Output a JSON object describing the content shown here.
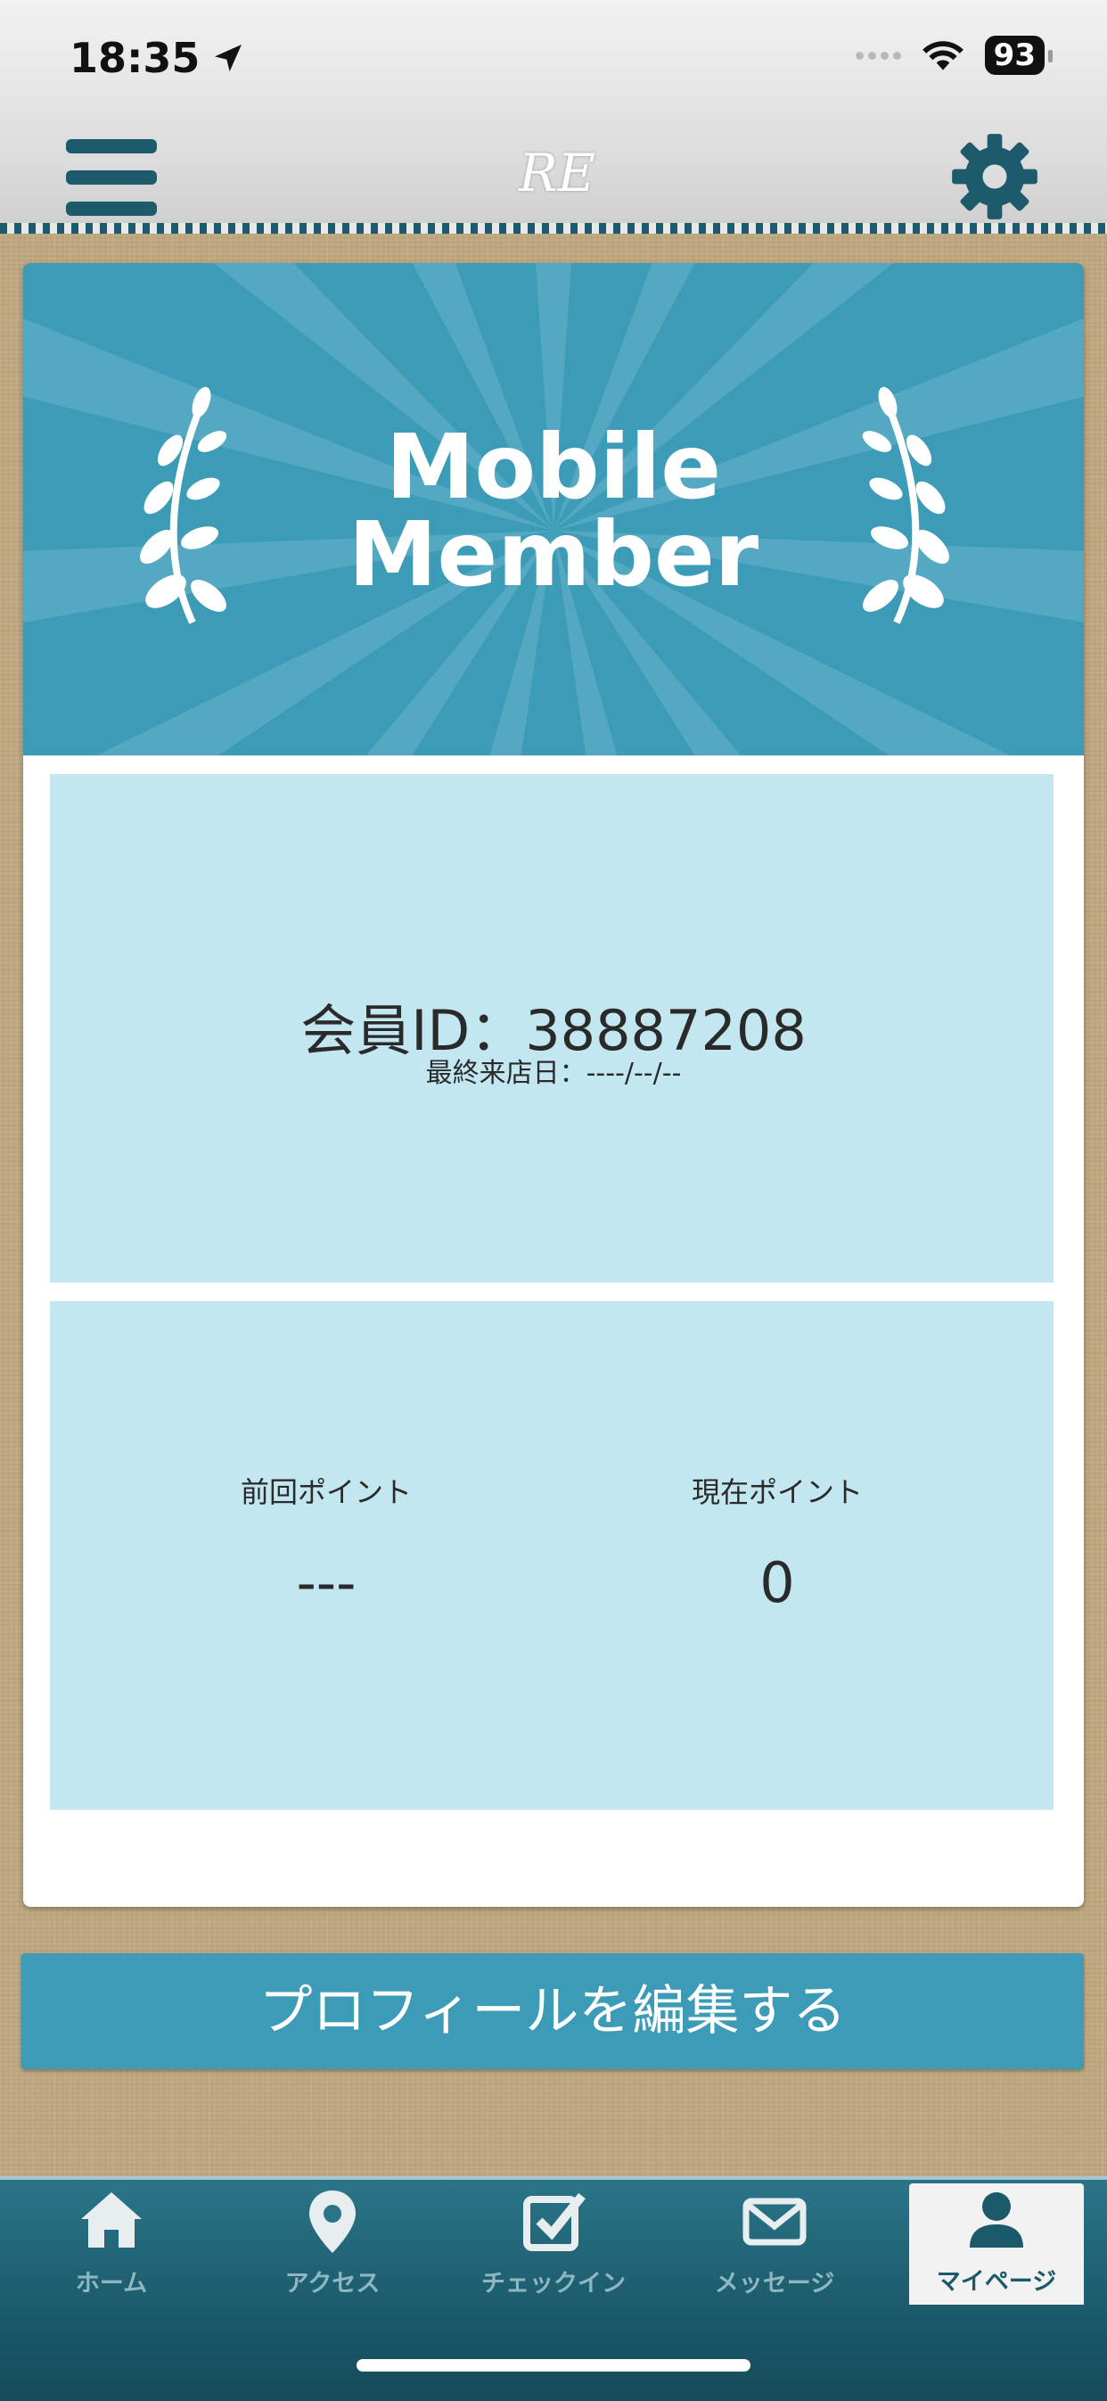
{
  "status_bar": {
    "time": "18:35",
    "battery": "93"
  },
  "header": {
    "logo_text": "RE"
  },
  "banner": {
    "title_line1": "Mobile",
    "title_line2": "Member"
  },
  "member": {
    "id_text": "会員ID：38887208",
    "last_visit_text": "最終来店日：----/--/--"
  },
  "points": {
    "previous_label": "前回ポイント",
    "previous_value": "---",
    "current_label": "現在ポイント",
    "current_value": "0"
  },
  "edit_profile_label": "プロフィールを編集する",
  "tabs": [
    {
      "label": "ホーム",
      "icon": "home-icon"
    },
    {
      "label": "アクセス",
      "icon": "map-pin-icon"
    },
    {
      "label": "チェックイン",
      "icon": "checkbox-icon"
    },
    {
      "label": "メッセージ",
      "icon": "envelope-icon"
    },
    {
      "label": "マイページ",
      "icon": "person-icon",
      "active": true
    }
  ],
  "colors": {
    "accent": "#3c9bb7",
    "dark": "#1d5a6b",
    "panel": "#c2e7f0"
  }
}
